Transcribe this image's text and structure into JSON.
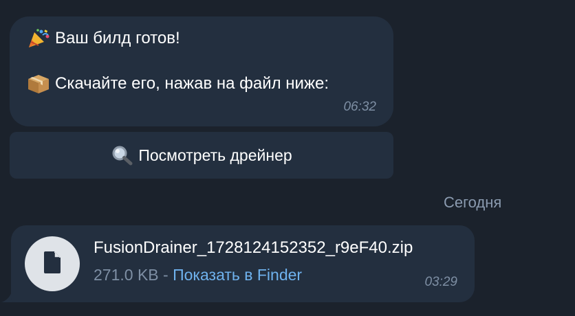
{
  "message_top": {
    "line1_emoji": "party-popper-icon",
    "line1_text": "Ваш билд готов!",
    "line2_emoji": "package-icon",
    "line2_text": "Скачайте его, нажав на файл ниже:",
    "time": "06:32"
  },
  "inline_button": {
    "icon": "magnifier-icon",
    "label": "Посмотреть дрейнер"
  },
  "date_separator": "Сегодня",
  "file_message": {
    "icon": "file-icon",
    "file_name": "FusionDrainer_1728124152352_r9eF40.zip",
    "size": "271.0 KB",
    "separator": " - ",
    "action_link": "Показать в Finder",
    "time": "03:29"
  },
  "colors": {
    "background": "#1b222c",
    "bubble": "#232f3f",
    "link": "#6fb2ee",
    "muted_text": "#7e8fa4"
  }
}
